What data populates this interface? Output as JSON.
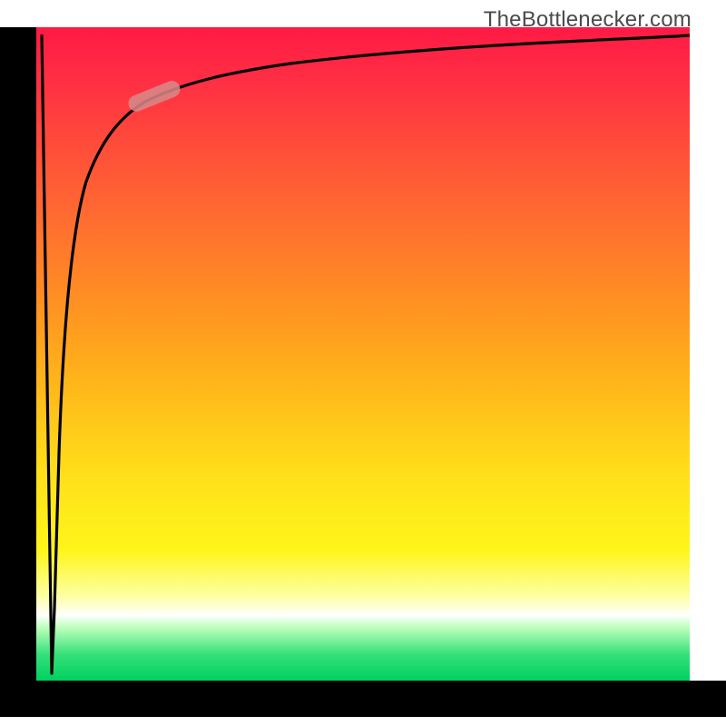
{
  "watermark": "TheBottlenecker.com",
  "colors": {
    "gradient_top": "#ff1a44",
    "gradient_mid1": "#ff9022",
    "gradient_mid2": "#ffde1a",
    "gradient_bottom": "#00d060",
    "curve": "#000000",
    "marker": "#d88a8a",
    "axes": "#000000"
  },
  "chart_data": {
    "type": "line",
    "title": "",
    "xlabel": "",
    "ylabel": "",
    "xlim": [
      0,
      100
    ],
    "ylim": [
      0,
      100
    ],
    "series": [
      {
        "name": "curve",
        "x": [
          2,
          3,
          4,
          5,
          6,
          8,
          10,
          12,
          15,
          18,
          22,
          28,
          36,
          48,
          64,
          82,
          100
        ],
        "y": [
          2,
          35,
          55,
          66,
          72,
          78,
          81,
          83,
          85,
          86.5,
          88,
          89.5,
          91,
          92.5,
          94,
          95.5,
          96.5
        ]
      }
    ],
    "marker": {
      "x_range": [
        15,
        22
      ],
      "y_range": [
        85,
        88
      ],
      "shape": "pill"
    },
    "background_gradient": {
      "direction": "vertical",
      "stops": [
        {
          "pos": 0.0,
          "color": "#ff1a44"
        },
        {
          "pos": 0.3,
          "color": "#ff6e30"
        },
        {
          "pos": 0.55,
          "color": "#ffb71a"
        },
        {
          "pos": 0.8,
          "color": "#fff51a"
        },
        {
          "pos": 0.9,
          "color": "#ffffff"
        },
        {
          "pos": 1.0,
          "color": "#00d060"
        }
      ]
    }
  }
}
